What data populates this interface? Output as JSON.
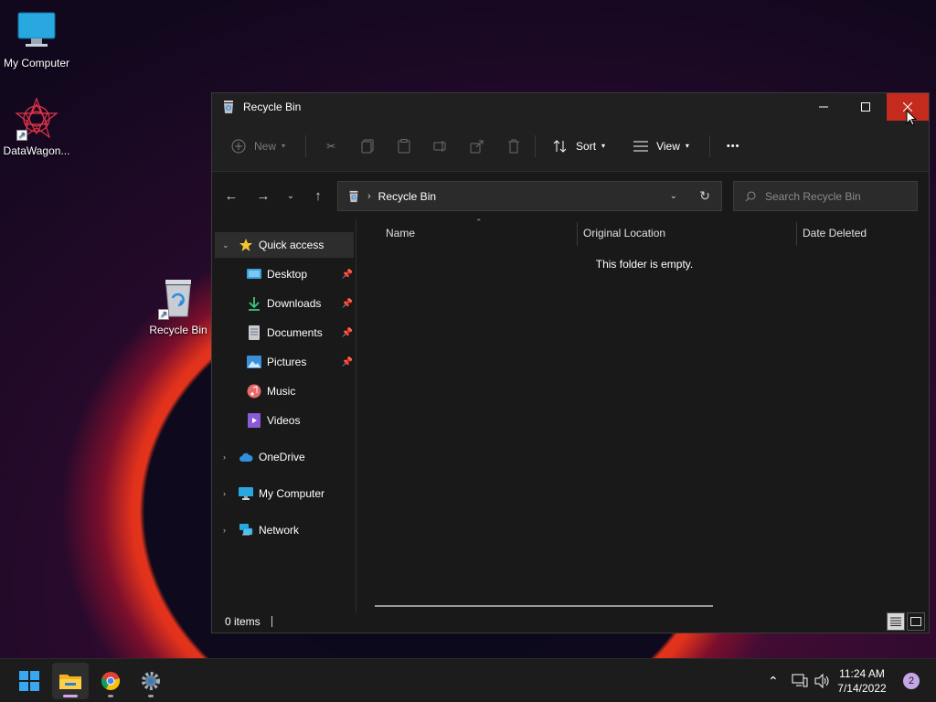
{
  "desktop": {
    "icons": [
      {
        "label": "My Computer"
      },
      {
        "label": "DataWagon..."
      },
      {
        "label": "Recycle Bin"
      }
    ]
  },
  "window": {
    "title": "Recycle Bin",
    "toolbar": {
      "new_label": "New",
      "sort_label": "Sort",
      "view_label": "View",
      "more_label": "•••"
    },
    "address": {
      "crumb": "Recycle Bin",
      "search_placeholder": "Search Recycle Bin"
    },
    "nav": {
      "quick_access": "Quick access",
      "items": [
        {
          "label": "Desktop"
        },
        {
          "label": "Downloads"
        },
        {
          "label": "Documents"
        },
        {
          "label": "Pictures"
        },
        {
          "label": "Music"
        },
        {
          "label": "Videos"
        }
      ],
      "onedrive": "OneDrive",
      "my_computer": "My Computer",
      "network": "Network"
    },
    "columns": {
      "name": "Name",
      "original_location": "Original Location",
      "date_deleted": "Date Deleted"
    },
    "empty_message": "This folder is empty.",
    "status": "0 items"
  },
  "taskbar": {
    "time": "11:24 AM",
    "date": "7/14/2022",
    "notification_count": "2"
  },
  "colors": {
    "close_button": "#c42b1c",
    "accent": "#0078d4"
  }
}
